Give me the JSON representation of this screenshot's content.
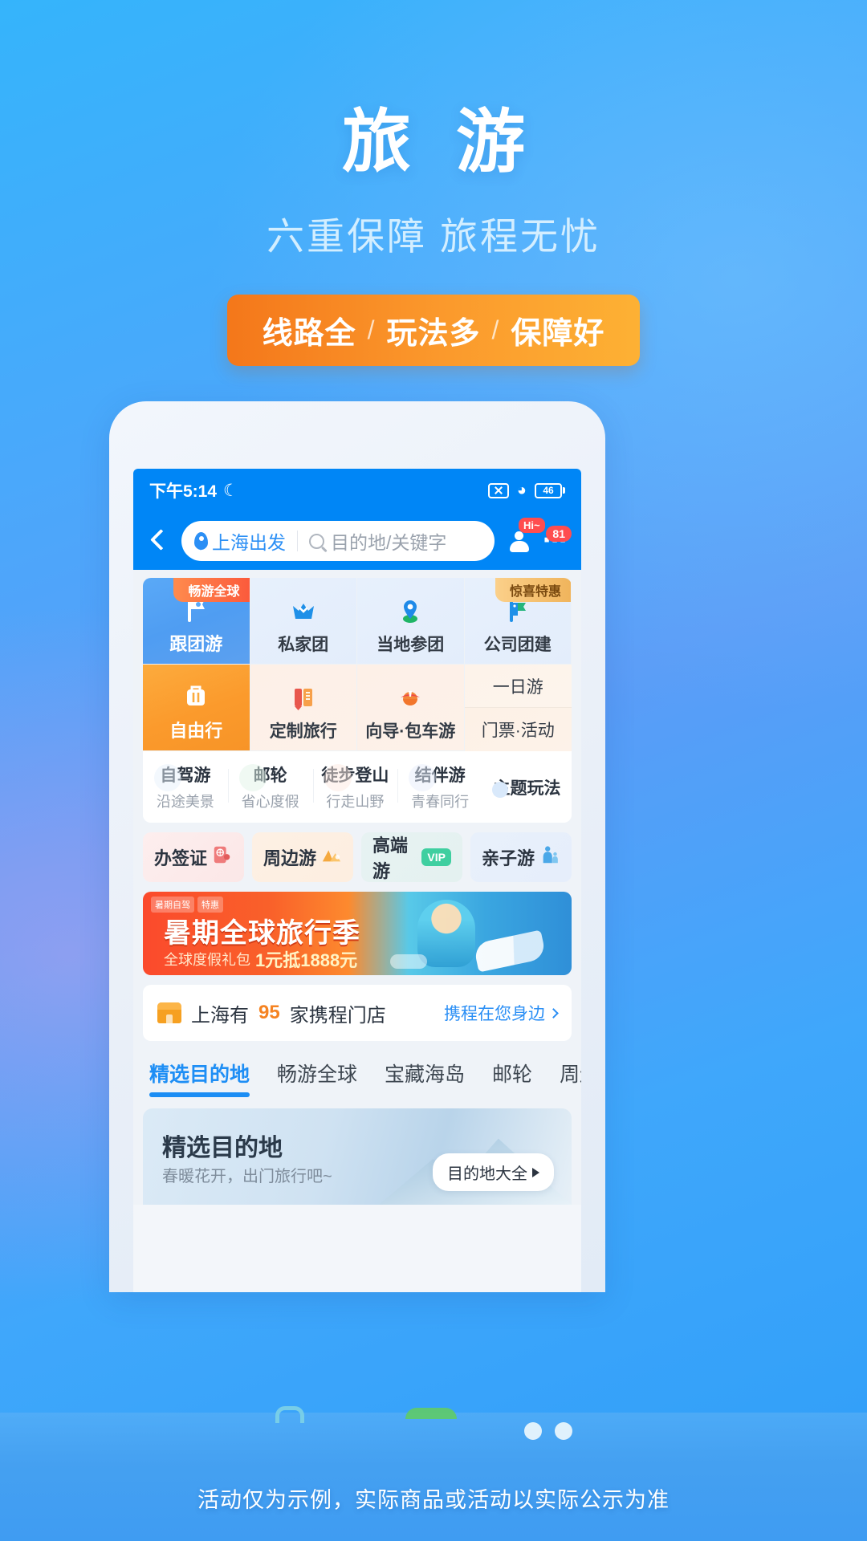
{
  "hero": {
    "title": "旅 游",
    "subtitle": "六重保障 旅程无忧",
    "pill": {
      "p1": "线路全",
      "sep1": "/",
      "p2": "玩法多",
      "sep2": "/",
      "p3": "保障好"
    },
    "accent_orange": "#f8921f",
    "accent_blue": "#3fa7fb"
  },
  "phone": {
    "statusbar": {
      "time": "下午5:14",
      "moon_icon": "crescent-moon-icon",
      "mute_icon": "mute-icon",
      "wifi_icon": "wifi-icon",
      "battery_level": "46"
    },
    "searchbar": {
      "back_icon": "back-chevron-icon",
      "departure": "上海出发",
      "placeholder": "目的地/关键字",
      "service_badge": "Hi~",
      "more_badge": "81",
      "more_icon": "more-dots-icon"
    },
    "grid": {
      "row1": [
        {
          "label": "跟团游",
          "badge": "畅游全球",
          "icon": "flag-star-icon",
          "style": "hero-blue"
        },
        {
          "label": "私家团",
          "badge": "",
          "icon": "crown-icon",
          "style": "blue"
        },
        {
          "label": "当地参团",
          "badge": "",
          "icon": "map-pin-icon",
          "style": "blue"
        },
        {
          "label": "公司团建",
          "badge": "惊喜特惠",
          "icon": "double-flag-icon",
          "style": "blue"
        }
      ],
      "row2": [
        {
          "label": "自由行",
          "icon": "suitcase-icon",
          "style": "hero-orange"
        },
        {
          "label": "定制旅行",
          "icon": "notebook-pen-icon",
          "style": "peach"
        },
        {
          "label": "向导·包车游",
          "icon": "guide-hat-icon",
          "style": "peach"
        }
      ],
      "col4_split": [
        {
          "label": "一日游"
        },
        {
          "label": "门票·活动"
        }
      ],
      "row3": [
        {
          "title": "自驾游",
          "sub": "沿途美景"
        },
        {
          "title": "邮轮",
          "sub": "省心度假"
        },
        {
          "title": "徒步登山",
          "sub": "行走山野"
        },
        {
          "title": "结伴游",
          "sub": "青春同行"
        }
      ],
      "theme": "主题玩法"
    },
    "chips": [
      {
        "label": "办签证",
        "icon": "passport-icon"
      },
      {
        "label": "周边游",
        "icon": "mountain-icon"
      },
      {
        "label": "高端游",
        "icon": "vip-icon",
        "tag": "VIP"
      },
      {
        "label": "亲子游",
        "icon": "parent-child-icon"
      }
    ],
    "banner": {
      "tag1": "暑期自驾",
      "tag2": "特惠",
      "title": "暑期全球旅行季",
      "sub_prefix": "全球度假礼包",
      "sub_highlight": "1元抵1888元"
    },
    "store": {
      "icon": "storefront-icon",
      "text_prefix": "上海有",
      "count": "95",
      "text_suffix": "家携程门店",
      "link": "携程在您身边",
      "chevron": "chevron-right-icon"
    },
    "tabs": [
      {
        "label": "精选目的地",
        "active": true
      },
      {
        "label": "畅游全球",
        "active": false
      },
      {
        "label": "宝藏海岛",
        "active": false
      },
      {
        "label": "邮轮",
        "active": false
      },
      {
        "label": "周边",
        "active": false
      }
    ],
    "dest_card": {
      "title": "精选目的地",
      "subtitle": "春暖花开，出门旅行吧~",
      "button": "目的地大全"
    }
  },
  "bottom": {
    "icons": [
      "palm-tree-icon",
      "drink-cup-icon",
      "watermelon-icon",
      "goggles-icon",
      "ice-cream-icon"
    ],
    "disclaimer": "活动仅为示例，实际商品或活动以实际公示为准"
  }
}
